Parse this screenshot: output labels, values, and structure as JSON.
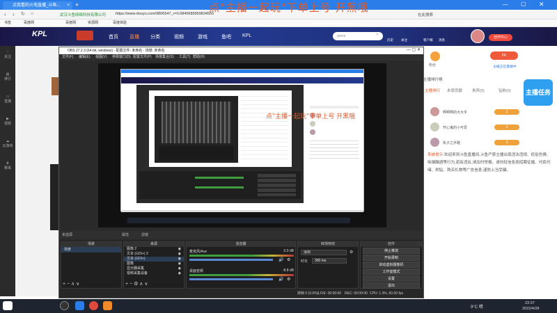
{
  "overlay_text": "点\"主播一起玩\"下单上号 开黑哦",
  "overlay_small": "点\"主播一起玩\"下单上号 开黑哦",
  "browser": {
    "tabs": [
      {
        "label": "点我看的火电直播_斗鱼..."
      },
      {
        "label": "点我看的火电直播_斗鱼直播"
      }
    ],
    "address": "https://www.douyu.com/9806547_r=0.0845689959834555",
    "security_label": "武汉斗鱼网络科技有限公司",
    "search_label": "在此搜索",
    "bookmarks": [
      "书签",
      "百度网",
      "百度网",
      "资源网",
      "百度体验",
      "专业问"
    ]
  },
  "site": {
    "logo": "KPL",
    "nav": [
      "首页",
      "直播",
      "分类",
      "视频",
      "游戏",
      "鱼吧",
      "KPL"
    ],
    "search_placeholder": "game",
    "header_icons": [
      "历史",
      "关注",
      "客户端",
      "消息",
      "斗鱼",
      "创作中心"
    ]
  },
  "rail": [
    "关注",
    "排行",
    "直播",
    "视频",
    "云游戏",
    "赛事"
  ],
  "obs": {
    "title": "OBS 27.2.3 (64-bit, windows) - 配置文件: 未命名 - 场景: 未命名",
    "menu": [
      "文件(F)",
      "编辑(E)",
      "视图(V)",
      "停靠窗口(D)",
      "配置文件(P)",
      "场景集合(S)",
      "工具(T)",
      "帮助(H)"
    ],
    "source_toolbar": [
      "未选源",
      "属性",
      "滤镜"
    ],
    "panels": {
      "scenes_title": "场景",
      "scenes": [
        "场景"
      ],
      "sources_title": "来源",
      "sources": [
        "图像 2",
        "文本 (GDI+) 3",
        "文本 (GDI+)",
        "图像",
        "显示器采集",
        "视频采集设备"
      ],
      "mixer_title": "混音器",
      "mixer": [
        {
          "name": "麦克风/Aux",
          "db": "0.0 dB"
        },
        {
          "name": "桌面音频",
          "db": "-8.8 dB"
        }
      ],
      "transitions_title": "转场特效",
      "transition_value": "淡出",
      "duration_label": "时长",
      "duration_value": "300 ms",
      "controls_title": "控件",
      "controls": [
        "停止推流",
        "开始录制",
        "启动虚拟摄像机",
        "工作室模式",
        "设置",
        "退出"
      ]
    },
    "status": {
      "dropped": "掉帧 0 (0.0%)",
      "live": "LIVE: 00:00:00",
      "rec": "REC: 00:00:00",
      "cpu": "CPU: 1.3%, 60.00 fps"
    }
  },
  "right": {
    "top_label": "粉丝",
    "top_btn": "主播正在直播中",
    "tabs": [
      "主播排行",
      "本周贡献",
      "贵宾(0)",
      "钻粉(0)"
    ],
    "rank_title": "主播排行榜",
    "ranks": [
      {
        "name": "啊啊啊的大大手",
        "badge": "1"
      },
      {
        "name": "开心鬼的小可爱",
        "badge": "2"
      },
      {
        "name": "执子之手踏",
        "badge": "3"
      }
    ],
    "notice_label": "系统提示:",
    "notice": "欢迎来到斗鱼直播间,斗鱼严禁主播出现违法违规、低俗色情、吸烟酗酒等行为,若有违反,请及时举报。请勿轻信各类招聘征婚、代练代储、刷钻、购买礼物等广告信息,谨防上当受骗。"
  },
  "promo": "主播任务",
  "taskbar": {
    "weather": "9°C 晴",
    "time": "23:37",
    "date": "2022/4/28"
  }
}
